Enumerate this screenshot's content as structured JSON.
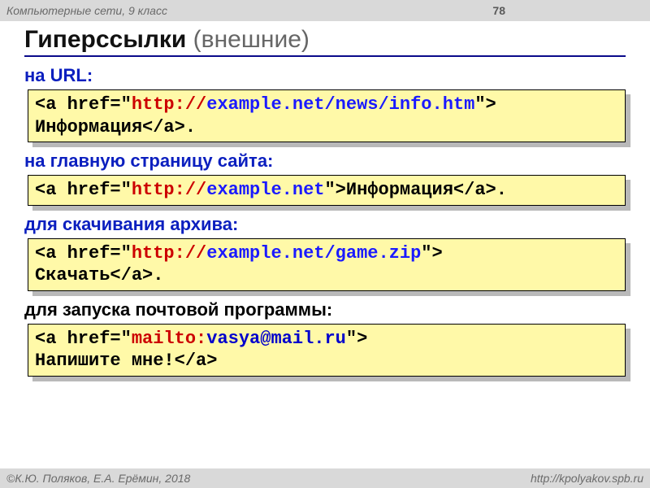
{
  "header": {
    "course": "Компьютерные сети, 9 класс",
    "page": "78"
  },
  "title": {
    "main": "Гиперссылки",
    "sub": " (внешние)"
  },
  "sections": [
    {
      "label": "на URL:",
      "parts": [
        {
          "cls": "t-black",
          "txt": "<a href=\""
        },
        {
          "cls": "t-red",
          "txt": "http://"
        },
        {
          "cls": "t-blue",
          "txt": "example.net/news/info.htm"
        },
        {
          "cls": "t-black",
          "txt": "\">\nИнформация</a>."
        }
      ]
    },
    {
      "label": "на главную страницу сайта:",
      "parts": [
        {
          "cls": "t-black",
          "txt": "<a href=\""
        },
        {
          "cls": "t-red",
          "txt": "http://"
        },
        {
          "cls": "t-blue",
          "txt": "example.net"
        },
        {
          "cls": "t-black",
          "txt": "\">Информация</a>."
        }
      ]
    },
    {
      "label": "для скачивания архива:",
      "parts": [
        {
          "cls": "t-black",
          "txt": "<a href=\""
        },
        {
          "cls": "t-red",
          "txt": "http://"
        },
        {
          "cls": "t-blue",
          "txt": "example.net/game.zip"
        },
        {
          "cls": "t-black",
          "txt": "\">\nСкачать</a>."
        }
      ]
    },
    {
      "label": "для запуска почтовой программы:",
      "label_black": true,
      "parts": [
        {
          "cls": "t-black",
          "txt": "<a href=\""
        },
        {
          "cls": "t-red",
          "txt": "mailto:"
        },
        {
          "cls": "t-dblue",
          "txt": "vasya@mail.ru"
        },
        {
          "cls": "t-black",
          "txt": "\">\nНапишите мне!</a>"
        }
      ]
    }
  ],
  "footer": {
    "left": "©К.Ю. Поляков, Е.А. Ерёмин, 2018",
    "right": "http://kpolyakov.spb.ru"
  }
}
